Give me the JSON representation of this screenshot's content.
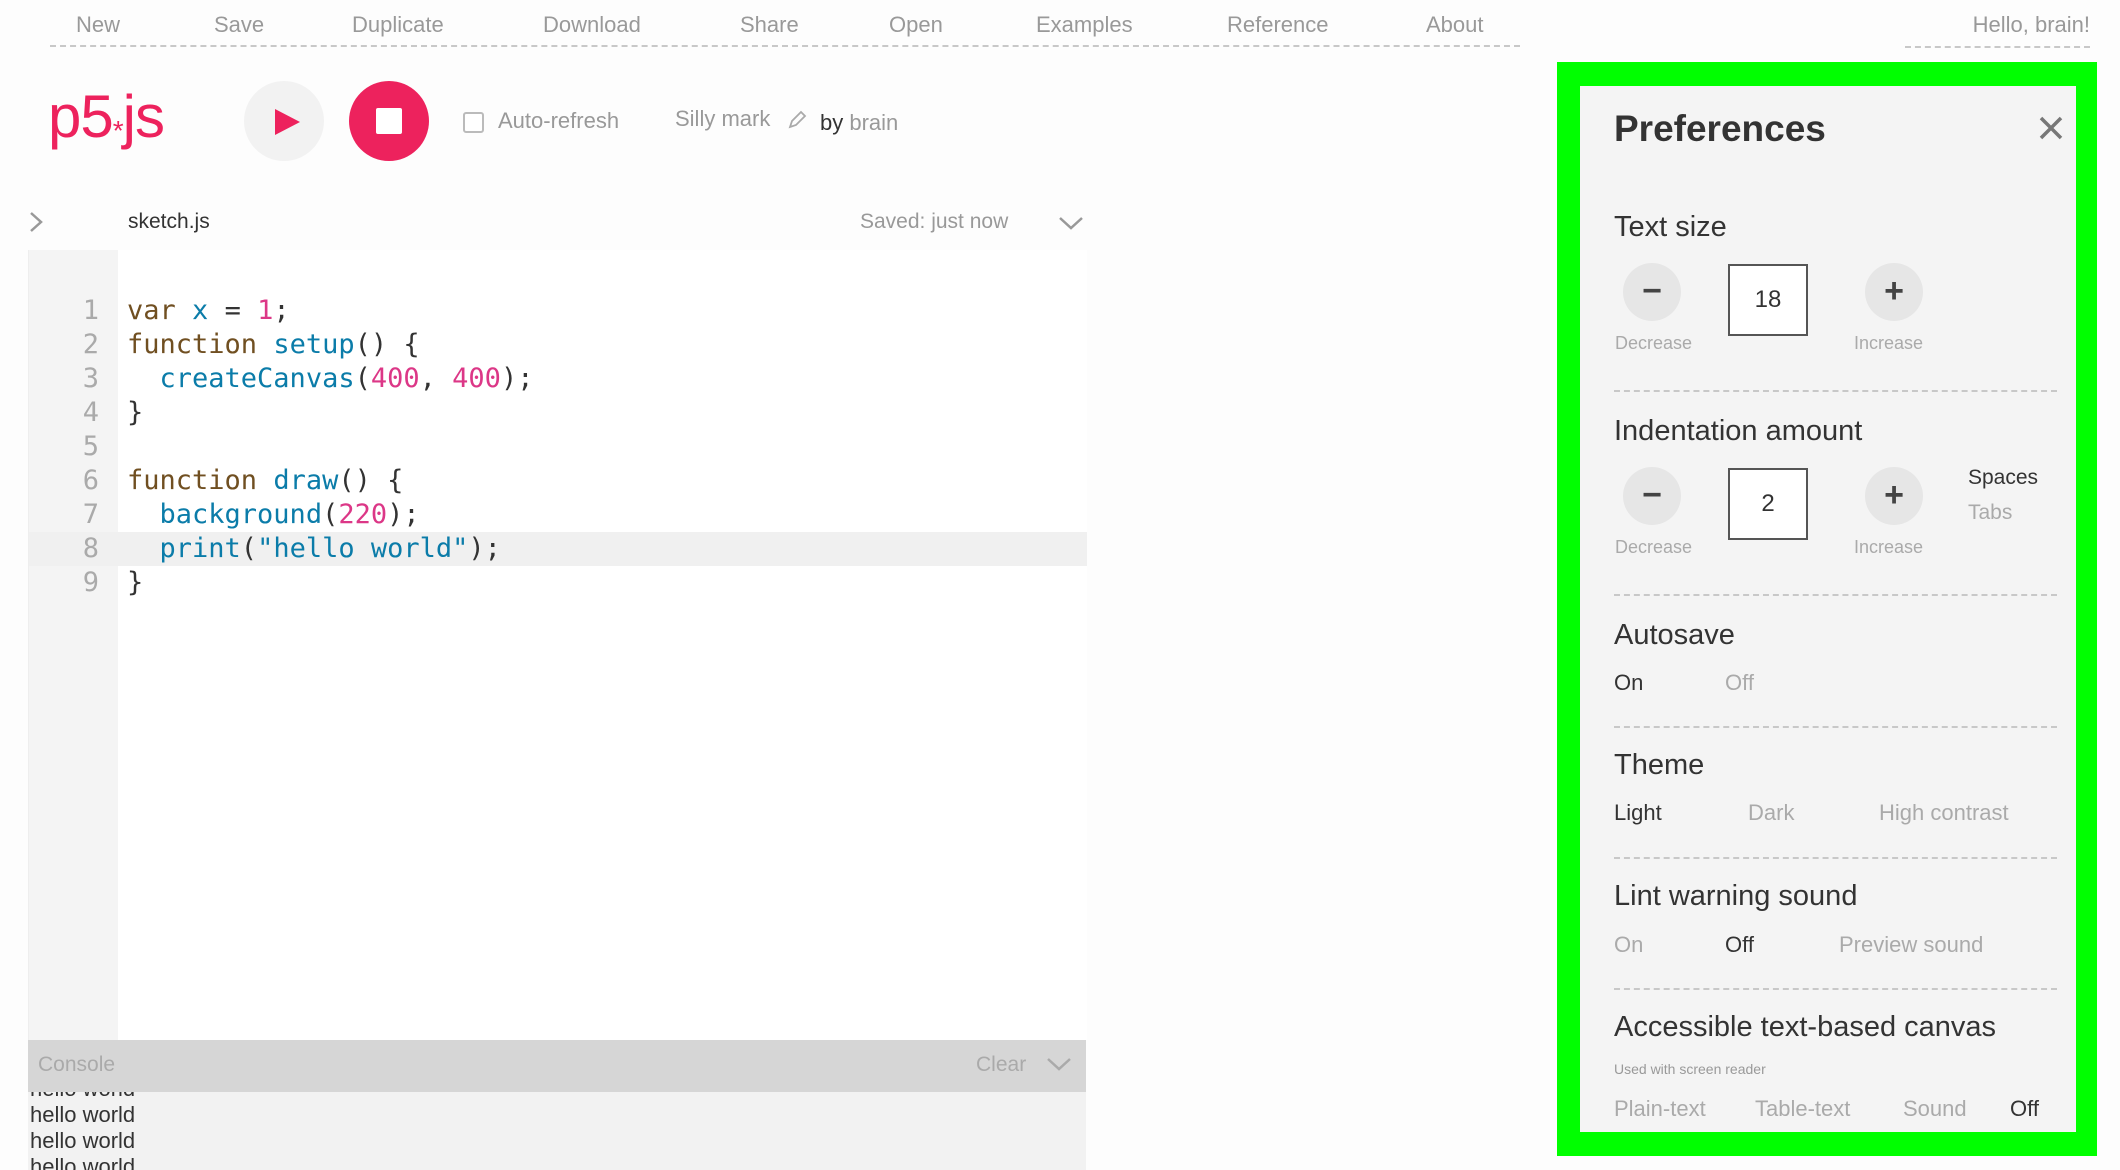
{
  "nav": {
    "items": [
      "New",
      "Save",
      "Duplicate",
      "Download",
      "Share",
      "Open",
      "Examples",
      "Reference",
      "About"
    ],
    "greeting": "Hello, brain!"
  },
  "toolbar": {
    "logo": "p5",
    "logo_star": "*",
    "logo_suffix": "js",
    "auto_refresh_label": "Auto-refresh",
    "auto_refresh_checked": false,
    "sketch_name": "Silly mark",
    "by_label": "by",
    "author": "brain",
    "accent_color": "#ed225d"
  },
  "file": {
    "name": "sketch.js",
    "status": "Saved: just now"
  },
  "editor": {
    "active_line": 8,
    "lines": [
      {
        "n": "1",
        "code": "var x = 1;"
      },
      {
        "n": "2",
        "code": "function setup() {"
      },
      {
        "n": "3",
        "code": "  createCanvas(400, 400);"
      },
      {
        "n": "4",
        "code": "}"
      },
      {
        "n": "5",
        "code": ""
      },
      {
        "n": "6",
        "code": "function draw() {"
      },
      {
        "n": "7",
        "code": "  background(220);"
      },
      {
        "n": "8",
        "code": "  print(\"hello world\");"
      },
      {
        "n": "9",
        "code": "}"
      }
    ]
  },
  "console": {
    "title": "Console",
    "clear_label": "Clear",
    "lines": [
      "hello world",
      "hello world",
      "hello world",
      "hello world"
    ]
  },
  "preferences": {
    "title": "Preferences",
    "highlight_color": "#00ff00",
    "text_size": {
      "title": "Text size",
      "value": "18",
      "decrease": "Decrease",
      "increase": "Increase"
    },
    "indentation": {
      "title": "Indentation amount",
      "value": "2",
      "decrease": "Decrease",
      "increase": "Increase",
      "spaces": "Spaces",
      "tabs": "Tabs",
      "selected": "Spaces"
    },
    "autosave": {
      "title": "Autosave",
      "on": "On",
      "off": "Off",
      "selected": "On"
    },
    "theme": {
      "title": "Theme",
      "light": "Light",
      "dark": "Dark",
      "high_contrast": "High contrast",
      "selected": "Light"
    },
    "lint": {
      "title": "Lint warning sound",
      "on": "On",
      "off": "Off",
      "preview": "Preview sound",
      "selected": "Off"
    },
    "accessible": {
      "title": "Accessible text-based canvas",
      "hint": "Used with screen reader",
      "plain": "Plain-text",
      "table": "Table-text",
      "sound": "Sound",
      "off": "Off",
      "selected": "Off"
    }
  }
}
